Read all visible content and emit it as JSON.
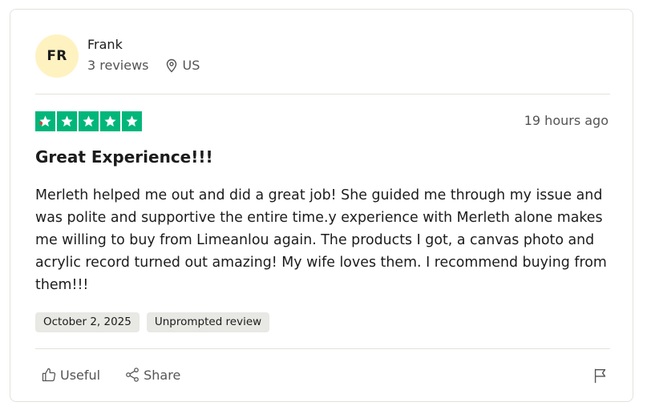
{
  "reviewer": {
    "initials": "FR",
    "name": "Frank",
    "review_count": "3 reviews",
    "location": "US",
    "icons": {
      "location": "map-pin-icon"
    }
  },
  "review": {
    "rating": 5,
    "rating_max": 5,
    "time_ago": "19 hours ago",
    "title": "Great Experience!!!",
    "body": "Merleth helped me out and did a great job! She guided me through my issue and was polite and supportive the entire time.y experience with Merleth alone makes me willing to buy from Limeanlou again. The products I got, a canvas photo and acrylic record turned out amazing! My wife loves them. I recommend buying from them!!!",
    "date": "October 2, 2025",
    "tag": "Unprompted review"
  },
  "actions": {
    "useful_label": "Useful",
    "share_label": "Share",
    "icons": {
      "useful": "thumbs-up-icon",
      "share": "share-icon",
      "report": "flag-icon"
    }
  },
  "colors": {
    "star_green": "#00b67a",
    "avatar_bg": "#fff2c1",
    "tag_bg": "#e8e8e4",
    "border": "#e2e2dc"
  }
}
